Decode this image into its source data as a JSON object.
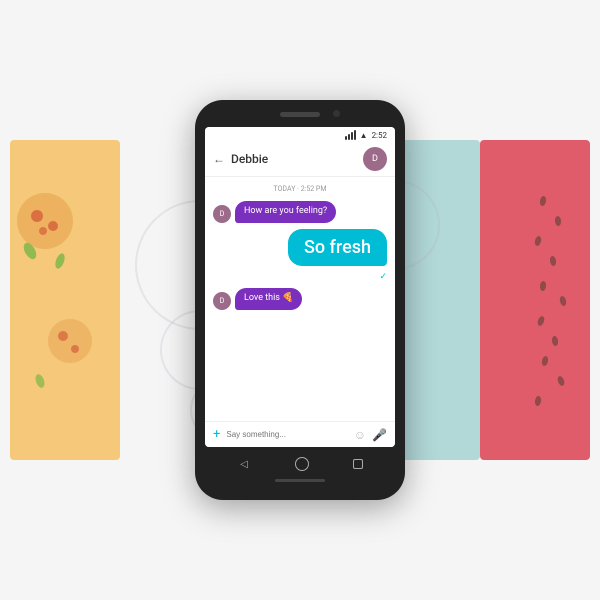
{
  "background": {
    "color": "#f5f5f5"
  },
  "strips": {
    "left_color": "#f5c87a",
    "mid_right_color": "#b2d8d8",
    "right_color": "#e05c6a"
  },
  "phone": {
    "status_bar": {
      "signal": "▲▲▲",
      "time": "2:52"
    },
    "header": {
      "back_label": "←",
      "contact_name": "Debbie",
      "avatar_initials": "D"
    },
    "chat": {
      "timestamp": "TODAY · 2:52 PM",
      "messages": [
        {
          "type": "incoming",
          "text": "How are you feeling?",
          "avatar": "D"
        },
        {
          "type": "outgoing",
          "text": "So fresh"
        },
        {
          "type": "incoming",
          "text": "Love this 🍕",
          "avatar": "D"
        }
      ]
    },
    "input_bar": {
      "plus_label": "+",
      "placeholder": "Say something...",
      "emoji_label": "☺",
      "mic_label": "🎤"
    },
    "nav": {
      "back_label": "◁",
      "home_label": "",
      "recent_label": ""
    }
  }
}
